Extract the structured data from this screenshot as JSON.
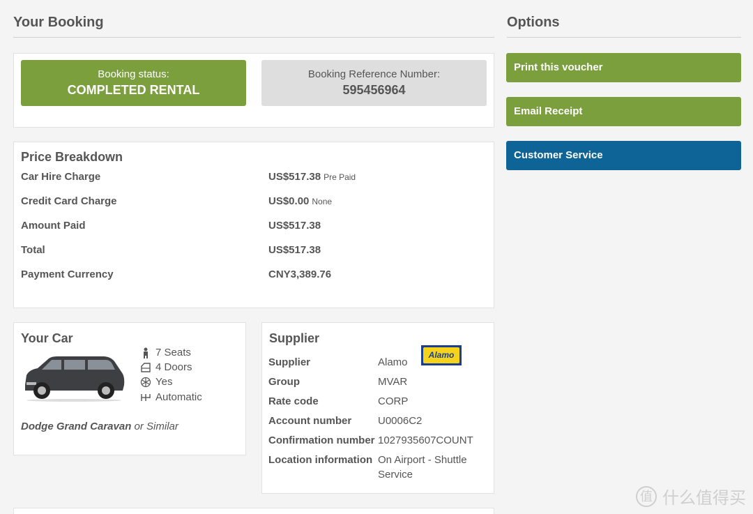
{
  "booking": {
    "heading": "Your Booking",
    "status_label": "Booking status:",
    "status_value": "COMPLETED RENTAL",
    "ref_label": "Booking Reference Number:",
    "ref_value": "595456964"
  },
  "price": {
    "title": "Price Breakdown",
    "rows": [
      {
        "label": "Car Hire Charge",
        "value": "US$517.38",
        "note": "Pre Paid"
      },
      {
        "label": "Credit Card Charge",
        "value": "US$0.00",
        "note": "None"
      },
      {
        "label": "Amount Paid",
        "value": "US$517.38",
        "note": ""
      },
      {
        "label": "Total",
        "value": "US$517.38",
        "note": ""
      },
      {
        "label": "Payment Currency",
        "value": "CNY3,389.76",
        "note": ""
      }
    ]
  },
  "car": {
    "title": "Your Car",
    "features": [
      {
        "icon": "person-icon",
        "text": "7 Seats"
      },
      {
        "icon": "door-icon",
        "text": "4 Doors"
      },
      {
        "icon": "snowflake-icon",
        "text": "Yes"
      },
      {
        "icon": "gearbox-icon",
        "text": "Automatic"
      }
    ],
    "model": "Dodge Grand Caravan",
    "model_suffix": "or Similar"
  },
  "supplier": {
    "title": "Supplier",
    "logo_text": "Alamo",
    "rows": [
      {
        "label": "Supplier",
        "value": "Alamo"
      },
      {
        "label": "Group",
        "value": "MVAR"
      },
      {
        "label": "Rate code",
        "value": "CORP"
      },
      {
        "label": "Account number",
        "value": "U0006C2"
      },
      {
        "label": "Confirmation number",
        "value": "1027935607COUNT"
      },
      {
        "label": "Location information",
        "value": "On Airport - Shuttle Service"
      }
    ]
  },
  "options": {
    "heading": "Options",
    "print": "Print this voucher",
    "email": "Email Receipt",
    "service": "Customer Service"
  },
  "watermark": {
    "glyph": "值",
    "text": "什么值得买"
  },
  "colors": {
    "green": "#7a9f3c",
    "blue": "#0e6496",
    "grey": "#dedede"
  }
}
